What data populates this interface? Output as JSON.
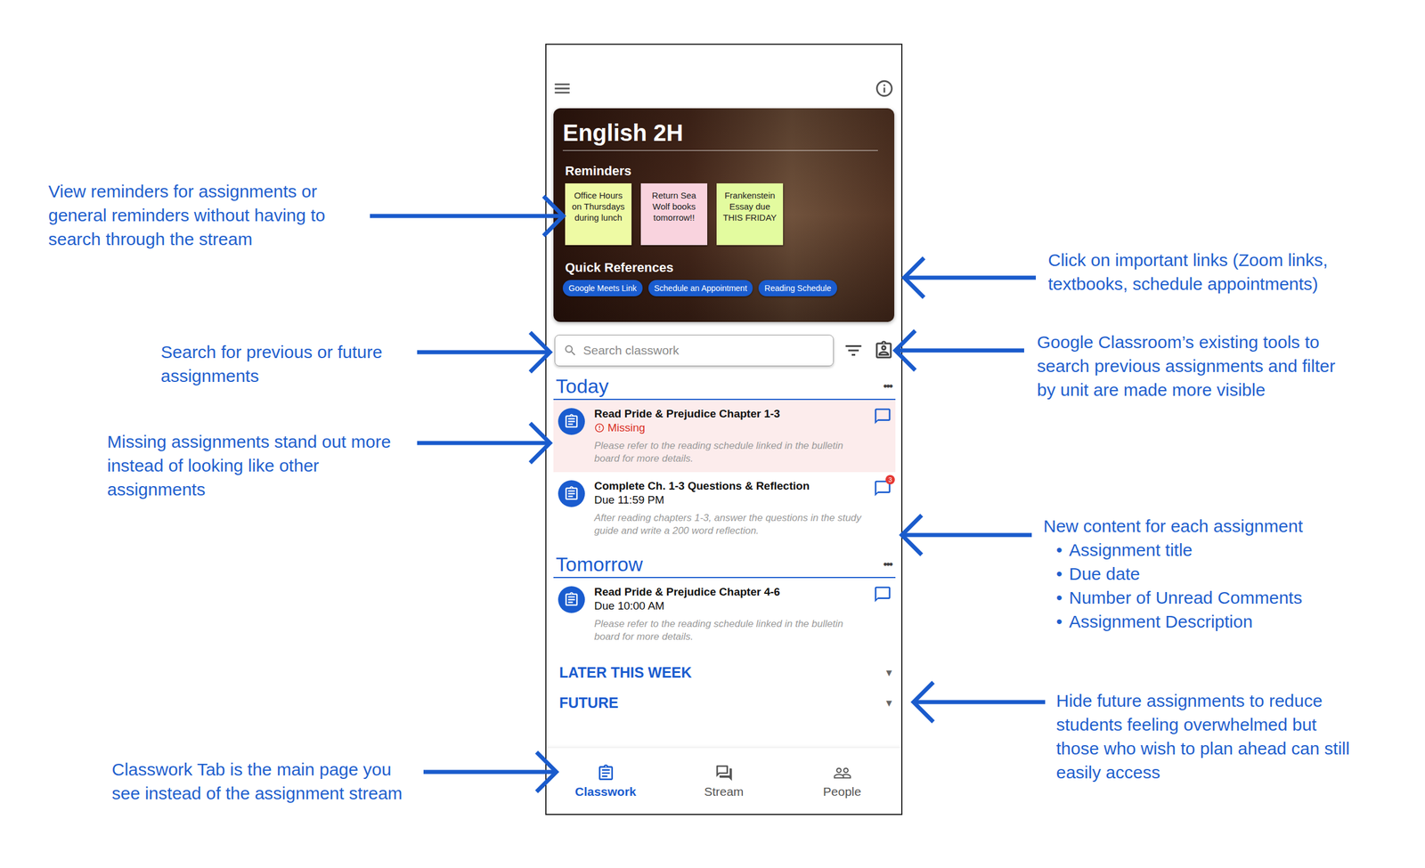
{
  "annotations": [
    {
      "lines": [
        "View reminders for assignments or",
        "general reminders without having to",
        "search through the stream"
      ]
    },
    {
      "lines": [
        "Click on important links (Zoom links,",
        "textbooks, schedule appointments)"
      ]
    },
    {
      "lines": [
        "Search for previous or future",
        "assignments"
      ]
    },
    {
      "lines": [
        "Google Classroom’s existing tools to",
        "search previous assignments and filter",
        "by unit are made more visible"
      ]
    },
    {
      "lines": [
        "Missing assignments stand out more",
        "instead of looking like other",
        "assignments"
      ]
    },
    {
      "lines": [
        "New content for each assignment"
      ],
      "bullet_mark": "•",
      "bullets": [
        "Assignment title",
        "Due date",
        "Number of Unread Comments",
        "Assignment Description"
      ]
    },
    {
      "lines": [
        "Hide future assignments to reduce",
        "students feeling overwhelmed but",
        "those who wish to plan ahead can still",
        "easily access"
      ]
    },
    {
      "lines": [
        "Classwork Tab is the main page you",
        "see instead of the assignment stream"
      ]
    }
  ],
  "course": {
    "title": "English 2H",
    "reminders_label": "Reminders",
    "reminders": [
      {
        "text": "Office Hours on Thursdays during lunch",
        "color": "#eefaa4"
      },
      {
        "text": "Return Sea Wolf books tomorrow!!",
        "color": "#f9d3de"
      },
      {
        "text": "Frankenstein Essay due THIS FRIDAY",
        "color": "#e3fb9f"
      }
    ],
    "references_label": "Quick References",
    "references": [
      "Google Meets Link",
      "Schedule an Appointment",
      "Reading Schedule"
    ]
  },
  "search": {
    "placeholder": "Search classwork"
  },
  "sections": [
    {
      "title": "Today",
      "more": "•••",
      "assignments": [
        {
          "title": "Read Pride & Prejudice Chapter 1-3",
          "status": "Missing",
          "missing": true,
          "description": "Please refer to the reading schedule linked in the bulletin board for more details."
        },
        {
          "title": "Complete Ch. 1-3 Questions & Reflection",
          "status": "Due 11:59 PM",
          "missing": false,
          "unread": "3",
          "description": "After reading chapters 1-3, answer the questions in the study guide and write a 200 word reflection."
        }
      ]
    },
    {
      "title": "Tomorrow",
      "more": "•••",
      "assignments": [
        {
          "title": "Read Pride & Prejudice Chapter 4-6",
          "status": "Due 10:00 AM",
          "missing": false,
          "description": "Please refer to the reading schedule linked in the bulletin board for more details."
        }
      ]
    }
  ],
  "collapsed_sections": [
    {
      "title": "LATER THIS WEEK",
      "caret": "▾",
      "expanded": false
    },
    {
      "title": "FUTURE",
      "caret": "▾",
      "expanded": false
    }
  ],
  "nav": [
    {
      "label": "Classwork",
      "selected": true
    },
    {
      "label": "Stream",
      "selected": false
    },
    {
      "label": "People",
      "selected": false
    }
  ]
}
